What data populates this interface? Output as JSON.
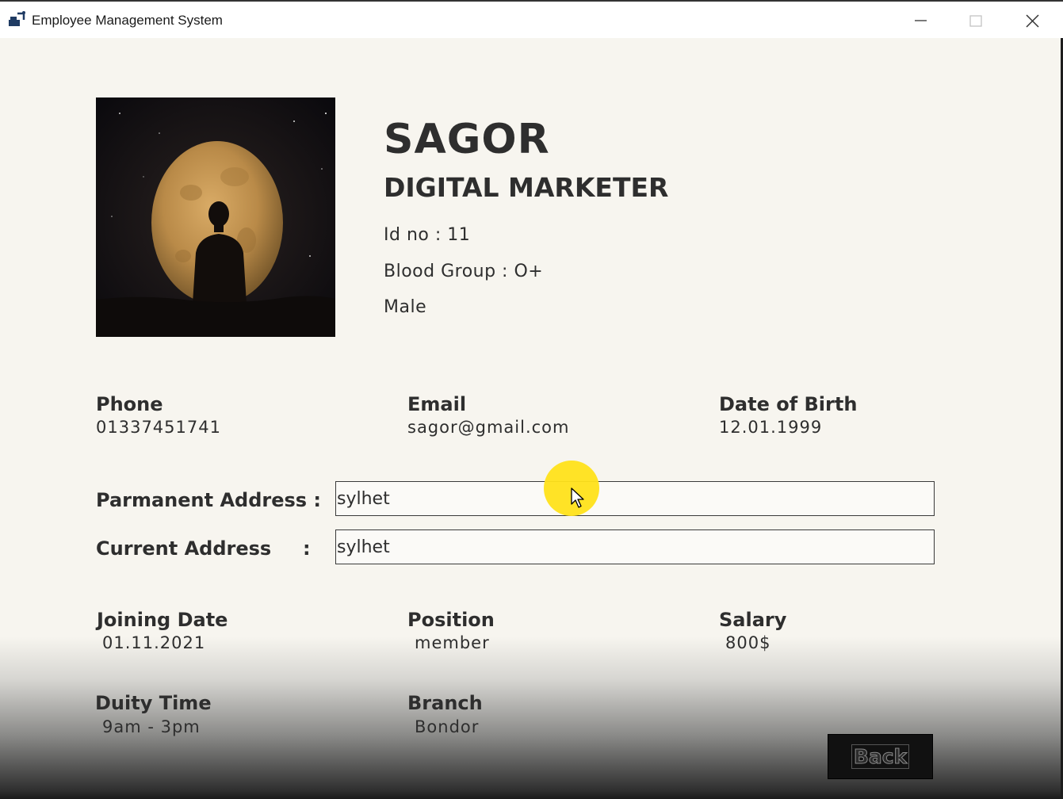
{
  "window": {
    "title": "Employee Management System",
    "icon": "app-icon",
    "controls": [
      "minimize-icon",
      "maximize-icon",
      "close-icon"
    ]
  },
  "profile": {
    "photo": "moon-silhouette-photo",
    "name": "SAGOR",
    "role": "DIGITAL MARKETER",
    "id_line": "Id no : 11",
    "blood_group_line": "Blood Group :  O+",
    "gender": "Male"
  },
  "contact": {
    "phone_label": "Phone",
    "phone_value": "01337451741",
    "email_label": "Email",
    "email_value": "sagor@gmail.com",
    "dob_label": "Date of Birth",
    "dob_value": "12.01.1999"
  },
  "address": {
    "permanent_label": "Parmanent Address :",
    "permanent_value": "sylhet",
    "current_label": "Current Address",
    "current_colon": ":",
    "current_value": "sylhet"
  },
  "job": {
    "joining_label": "Joining Date",
    "joining_value": "01.11.2021",
    "position_label": "Position",
    "position_value": "member",
    "salary_label": "Salary",
    "salary_value": "800$",
    "duty_label": "Duity Time",
    "duty_value": "9am - 3pm",
    "branch_label": "Branch",
    "branch_value": "Bondor"
  },
  "actions": {
    "back_label": "Back"
  },
  "colors": {
    "background": "#f7f5ef",
    "text": "#2e2e2e",
    "button": "#111111",
    "cursor_highlight": "#ffe21a"
  }
}
